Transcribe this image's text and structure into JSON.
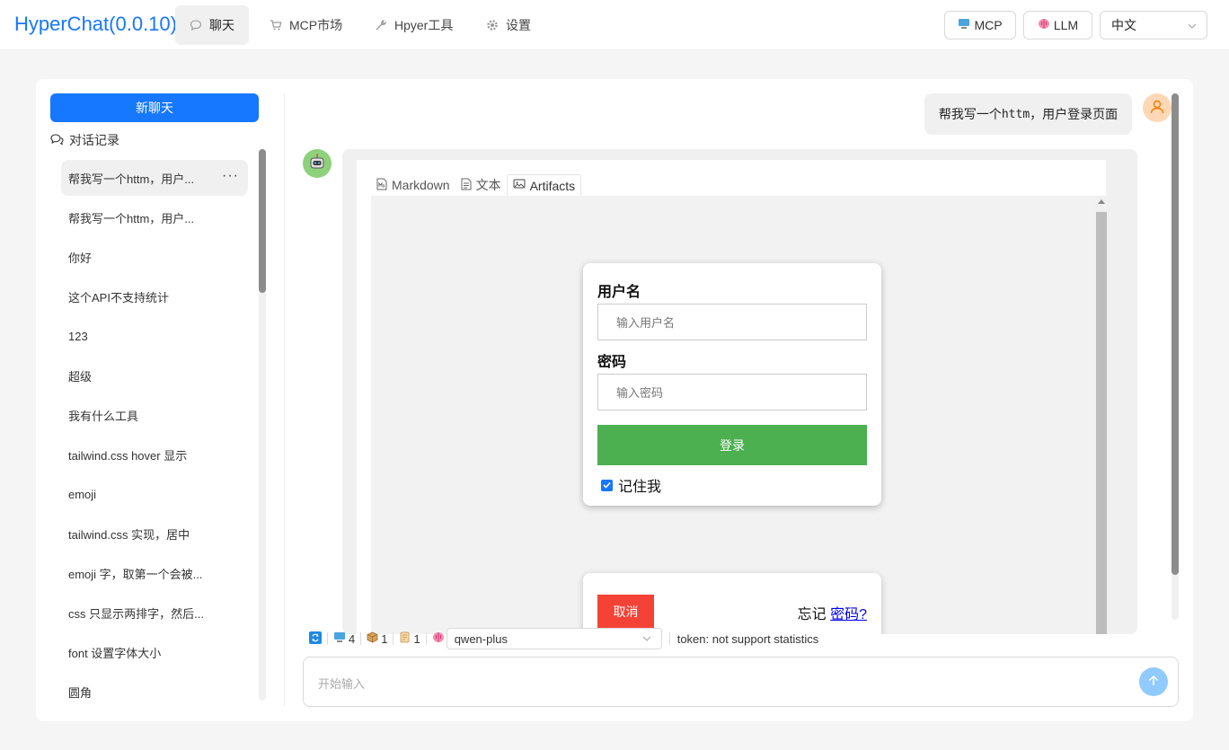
{
  "app": {
    "title": "HyperChat(0.0.10)"
  },
  "nav": [
    {
      "label": "聊天",
      "icon": "chat-bubble-icon"
    },
    {
      "label": "MCP市场",
      "icon": "cart-icon"
    },
    {
      "label": "Hpyer工具",
      "icon": "tool-icon"
    },
    {
      "label": "设置",
      "icon": "gear-icon"
    }
  ],
  "header": {
    "mcp_label": "MCP",
    "llm_label": "LLM",
    "language": "中文"
  },
  "sidebar": {
    "new_chat": "新聊天",
    "history_title": "对话记录",
    "items": [
      "帮我写一个httm，用户...",
      "帮我写一个httm，用户...",
      "你好",
      "这个API不支持统计",
      "123",
      "超级",
      "我有什么工具",
      "tailwind.css hover 显示",
      "emoji",
      "tailwind.css 实现，居中",
      "emoji 字，取第一个会被...",
      "css 只显示两排字，然后...",
      "font 设置字体大小",
      "圆角"
    ]
  },
  "chat": {
    "user_message_prefix": "帮我写一个",
    "user_message_code": "httm",
    "user_message_suffix": "，用户登录页面",
    "tabs": [
      "Markdown",
      "文本",
      "Artifacts"
    ],
    "artifact": {
      "username_label": "用户名",
      "username_placeholder": "输入用户名",
      "password_label": "密码",
      "password_placeholder": "输入密码",
      "login_button": "登录",
      "remember_me": "记住我",
      "cancel_button": "取消",
      "forgot_prefix": "忘记",
      "forgot_link": "密码?"
    }
  },
  "toolbar": {
    "mcp_count": "4",
    "tools_count": "1",
    "prompts_count": "1",
    "model": "qwen-plus",
    "token_text": "token: not support statistics"
  },
  "input": {
    "placeholder": "开始输入"
  },
  "colors": {
    "accent": "#1677ff",
    "login_green": "#4caf50",
    "cancel_red": "#f44336"
  }
}
